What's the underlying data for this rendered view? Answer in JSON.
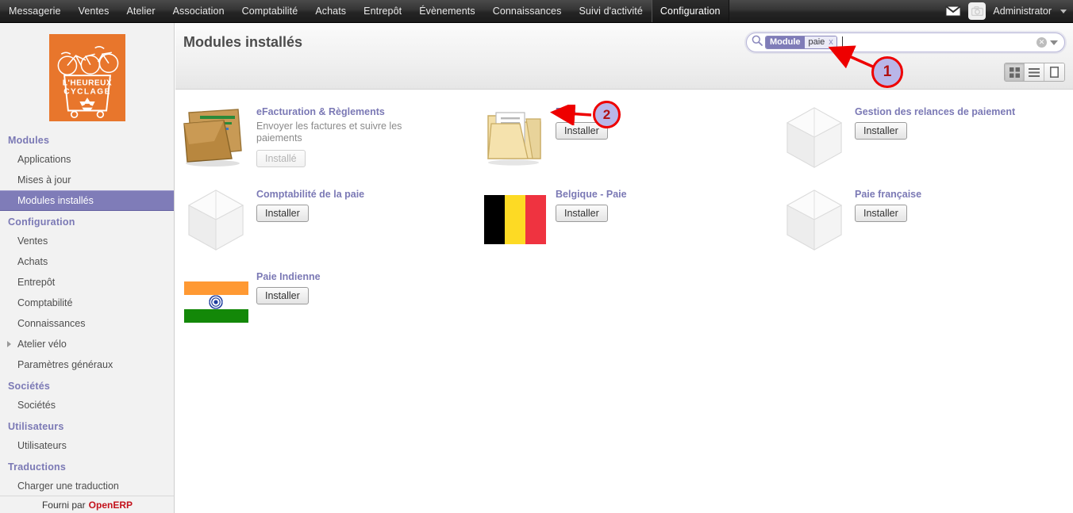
{
  "topbar": {
    "menu": [
      {
        "label": "Messagerie",
        "active": false
      },
      {
        "label": "Ventes",
        "active": false
      },
      {
        "label": "Atelier",
        "active": false
      },
      {
        "label": "Association",
        "active": false
      },
      {
        "label": "Comptabilité",
        "active": false
      },
      {
        "label": "Achats",
        "active": false
      },
      {
        "label": "Entrepôt",
        "active": false
      },
      {
        "label": "Évènements",
        "active": false
      },
      {
        "label": "Connaissances",
        "active": false
      },
      {
        "label": "Suivi d'activité",
        "active": false
      },
      {
        "label": "Configuration",
        "active": true
      }
    ],
    "mail_icon": "envelope-icon",
    "avatar_icon": "camera-placeholder-icon",
    "user": "Administrator",
    "caret_icon": "chevron-down-icon"
  },
  "sidebar": {
    "logo": {
      "name": "heureux-cyclage-logo",
      "line1": "L'HEUREUX",
      "line2": "CYCLAGE",
      "color": "#E8762C"
    },
    "sections": [
      {
        "title": "Modules",
        "items": [
          {
            "label": "Applications",
            "selected": false,
            "expandable": false
          },
          {
            "label": "Mises à jour",
            "selected": false,
            "expandable": false
          },
          {
            "label": "Modules installés",
            "selected": true,
            "expandable": false
          }
        ]
      },
      {
        "title": "Configuration",
        "items": [
          {
            "label": "Ventes",
            "selected": false,
            "expandable": false
          },
          {
            "label": "Achats",
            "selected": false,
            "expandable": false
          },
          {
            "label": "Entrepôt",
            "selected": false,
            "expandable": false
          },
          {
            "label": "Comptabilité",
            "selected": false,
            "expandable": false
          },
          {
            "label": "Connaissances",
            "selected": false,
            "expandable": false
          },
          {
            "label": "Atelier vélo",
            "selected": false,
            "expandable": true
          },
          {
            "label": "Paramètres généraux",
            "selected": false,
            "expandable": false
          }
        ]
      },
      {
        "title": "Sociétés",
        "items": [
          {
            "label": "Sociétés",
            "selected": false,
            "expandable": false
          }
        ]
      },
      {
        "title": "Utilisateurs",
        "items": [
          {
            "label": "Utilisateurs",
            "selected": false,
            "expandable": false
          }
        ]
      },
      {
        "title": "Traductions",
        "items": [
          {
            "label": "Charger une traduction",
            "selected": false,
            "expandable": false
          }
        ]
      }
    ],
    "footer_prefix": "Fourni par",
    "footer_brand": "OpenERP"
  },
  "main": {
    "title": "Modules installés",
    "search": {
      "icon": "search-icon",
      "facet_label": "Module",
      "facet_value": "paie",
      "facet_remove": "x",
      "placeholder": "",
      "value": "",
      "clear_icon": "clear-circle-icon",
      "dropdown_icon": "chevron-down-icon"
    },
    "views": [
      {
        "name": "kanban-view-button",
        "icon": "grid-icon",
        "active": true
      },
      {
        "name": "list-view-button",
        "icon": "list-icon",
        "active": false
      },
      {
        "name": "form-view-button",
        "icon": "form-icon",
        "active": false
      }
    ],
    "modules": [
      {
        "title": "eFacturation & Règlements",
        "description": "Envoyer les factures et suivre les paiements",
        "button": "Installé",
        "installed": true,
        "icon": "folder-invoices-icon"
      },
      {
        "title": "Paie",
        "description": "",
        "button": "Installer",
        "installed": false,
        "icon": "folder-documents-icon"
      },
      {
        "title": "Gestion des relances de paiement",
        "description": "",
        "button": "Installer",
        "installed": false,
        "icon": "cube-icon"
      },
      {
        "title": "Comptabilité de la paie",
        "description": "",
        "button": "Installer",
        "installed": false,
        "icon": "cube-icon"
      },
      {
        "title": "Belgique - Paie",
        "description": "",
        "button": "Installer",
        "installed": false,
        "icon": "belgium-flag-icon"
      },
      {
        "title": "Paie française",
        "description": "",
        "button": "Installer",
        "installed": false,
        "icon": "cube-icon"
      },
      {
        "title": "Paie Indienne",
        "description": "",
        "button": "Installer",
        "installed": false,
        "icon": "india-flag-icon"
      }
    ]
  },
  "annotations": [
    {
      "label": "1",
      "target": "search-input"
    },
    {
      "label": "2",
      "target": "paie-install-button"
    }
  ],
  "colors": {
    "accent_purple": "#7b79b5",
    "selected_purple": "#7f7cb8",
    "annotation_red": "#ee0000",
    "annotation_fill": "#b9b6e8",
    "brand_red": "#c3121c",
    "logo_orange": "#E8762C"
  }
}
